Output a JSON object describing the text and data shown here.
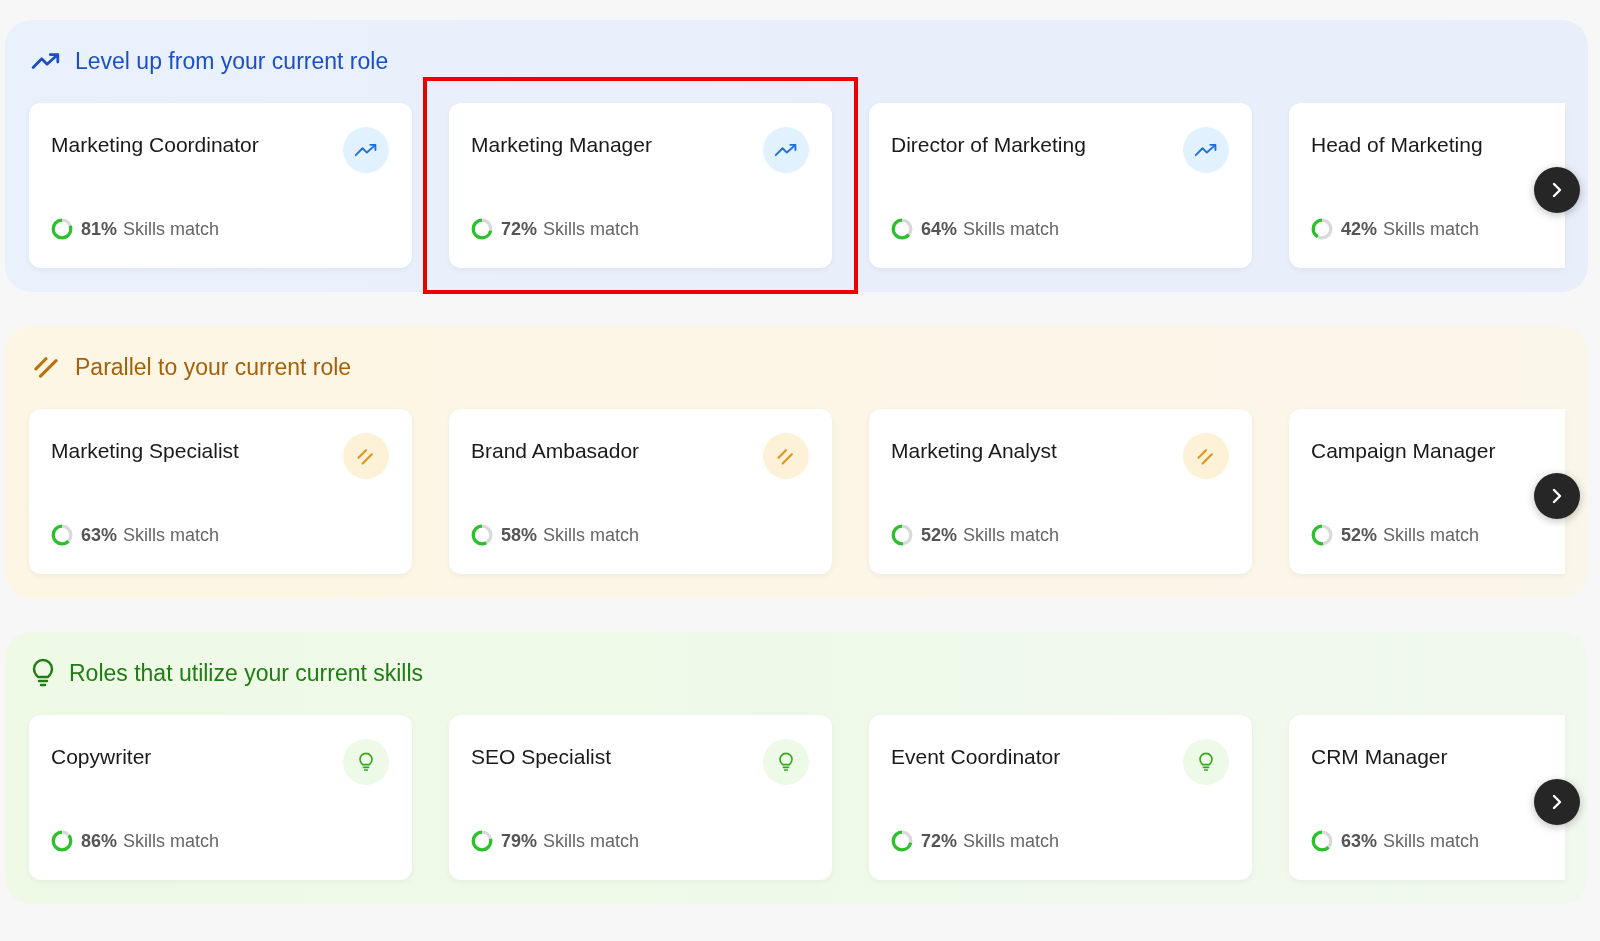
{
  "sections": [
    {
      "kind": "levelup",
      "title": "Level up from your current role",
      "cards": [
        {
          "title": "Marketing Coordinator",
          "percent": "81%",
          "match_label": "Skills match",
          "level": 0.81,
          "icon": true,
          "highlighted": false
        },
        {
          "title": "Marketing Manager",
          "percent": "72%",
          "match_label": "Skills match",
          "level": 0.72,
          "icon": true,
          "highlighted": true
        },
        {
          "title": "Director of Marketing",
          "percent": "64%",
          "match_label": "Skills match",
          "level": 0.64,
          "icon": true,
          "highlighted": false
        },
        {
          "title": "Head of Marketing",
          "percent": "42%",
          "match_label": "Skills match",
          "level": 0.42,
          "icon": false,
          "highlighted": false
        }
      ]
    },
    {
      "kind": "parallel",
      "title": "Parallel to your current role",
      "cards": [
        {
          "title": "Marketing Specialist",
          "percent": "63%",
          "match_label": "Skills match",
          "level": 0.63,
          "icon": true,
          "highlighted": false
        },
        {
          "title": "Brand Ambasador",
          "percent": "58%",
          "match_label": "Skills match",
          "level": 0.58,
          "icon": true,
          "highlighted": false
        },
        {
          "title": "Marketing Analyst",
          "percent": "52%",
          "match_label": "Skills match",
          "level": 0.52,
          "icon": true,
          "highlighted": false
        },
        {
          "title": "Campaign Manager",
          "percent": "52%",
          "match_label": "Skills match",
          "level": 0.52,
          "icon": false,
          "highlighted": false
        }
      ]
    },
    {
      "kind": "skills",
      "title": "Roles that utilize your current skills",
      "cards": [
        {
          "title": "Copywriter",
          "percent": "86%",
          "match_label": "Skills match",
          "level": 0.86,
          "icon": true,
          "highlighted": false
        },
        {
          "title": "SEO Specialist",
          "percent": "79%",
          "match_label": "Skills match",
          "level": 0.79,
          "icon": true,
          "highlighted": false
        },
        {
          "title": "Event Coordinator",
          "percent": "72%",
          "match_label": "Skills match",
          "level": 0.72,
          "icon": true,
          "highlighted": false
        },
        {
          "title": "CRM Manager",
          "percent": "63%",
          "match_label": "Skills match",
          "level": 0.63,
          "icon": false,
          "highlighted": false
        }
      ]
    }
  ]
}
